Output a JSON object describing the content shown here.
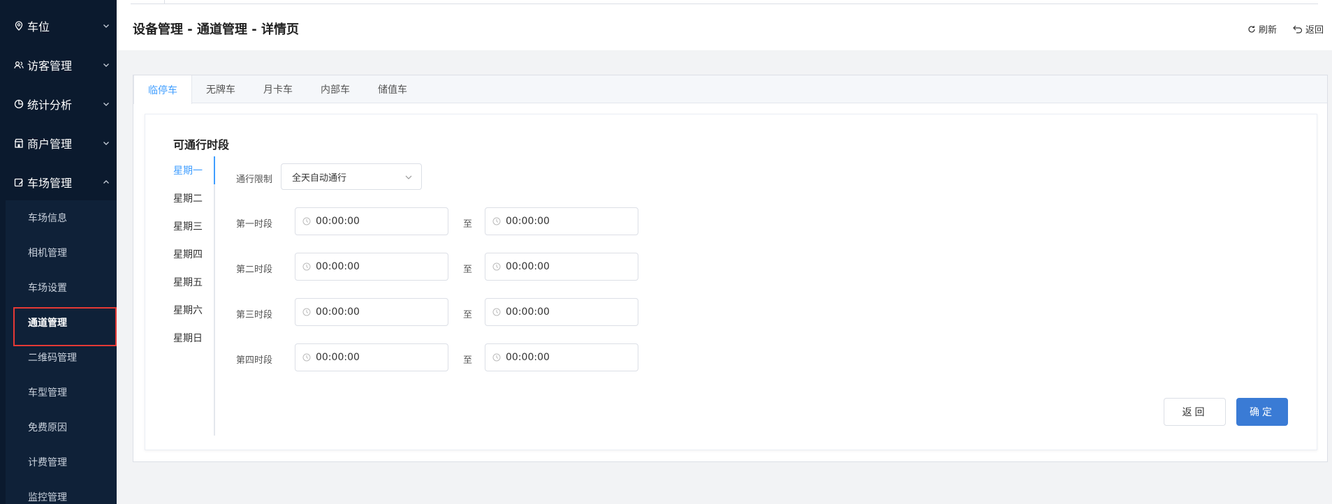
{
  "sidebar": {
    "groups": [
      {
        "label": "车位",
        "icon": "location-pin-icon",
        "chevron": "down"
      },
      {
        "label": "访客管理",
        "icon": "users-icon",
        "chevron": "down"
      },
      {
        "label": "统计分析",
        "icon": "pie-chart-icon",
        "chevron": "down"
      },
      {
        "label": "商户管理",
        "icon": "store-icon",
        "chevron": "down"
      },
      {
        "label": "车场管理",
        "icon": "parking-icon",
        "chevron": "up"
      }
    ],
    "submenu": [
      {
        "label": "车场信息"
      },
      {
        "label": "相机管理"
      },
      {
        "label": "车场设置"
      },
      {
        "label": "通道管理",
        "active": true
      },
      {
        "label": "二维码管理"
      },
      {
        "label": "车型管理"
      },
      {
        "label": "免费原因"
      },
      {
        "label": "计费管理"
      },
      {
        "label": "监控管理"
      }
    ]
  },
  "header": {
    "title": "设备管理 - 通道管理 - 详情页",
    "refresh_label": "刷新",
    "back_label": "返回"
  },
  "tabs": [
    {
      "label": "临停车",
      "active": true
    },
    {
      "label": "无牌车"
    },
    {
      "label": "月卡车"
    },
    {
      "label": "内部车"
    },
    {
      "label": "储值车"
    }
  ],
  "section_title": "可通行时段",
  "days": [
    {
      "label": "星期一",
      "active": true
    },
    {
      "label": "星期二"
    },
    {
      "label": "星期三"
    },
    {
      "label": "星期四"
    },
    {
      "label": "星期五"
    },
    {
      "label": "星期六"
    },
    {
      "label": "星期日"
    }
  ],
  "form": {
    "restriction_label": "通行限制",
    "restriction_value": "全天自动通行",
    "to_label": "至",
    "periods": [
      {
        "label": "第一时段",
        "start": "00:00:00",
        "end": "00:00:00"
      },
      {
        "label": "第二时段",
        "start": "00:00:00",
        "end": "00:00:00"
      },
      {
        "label": "第三时段",
        "start": "00:00:00",
        "end": "00:00:00"
      },
      {
        "label": "第四时段",
        "start": "00:00:00",
        "end": "00:00:00"
      }
    ]
  },
  "actions": {
    "back_label": "返回",
    "confirm_label": "确定"
  },
  "colors": {
    "sidebar_bg": "#0b1a2e",
    "accent": "#409eff",
    "primary_button": "#3a7bd5",
    "highlight_box": "#e53935"
  }
}
